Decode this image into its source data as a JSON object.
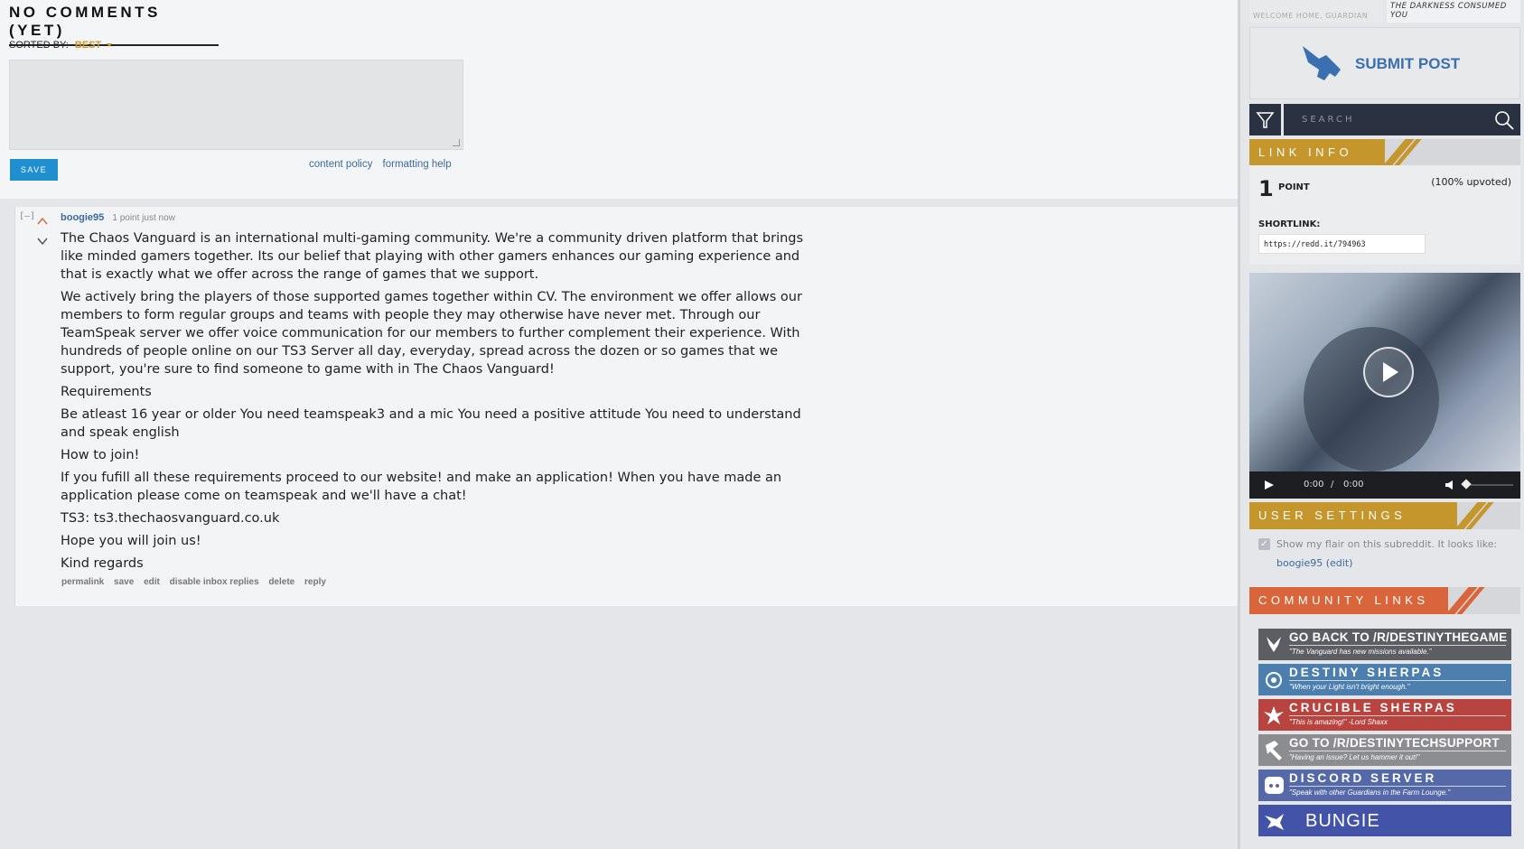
{
  "comments_header": "NO COMMENTS (YET)",
  "sort": {
    "label": "SORTED BY:",
    "value": "BEST"
  },
  "editor": {
    "save_label": "SAVE",
    "content_policy": "content policy",
    "formatting_help": "formatting help"
  },
  "comment": {
    "collapse": "[–]",
    "author": "boogie95",
    "meta": "1 point just now",
    "paragraphs": [
      "The Chaos Vanguard is an international multi-gaming community. We're a community driven platform that brings like minded gamers together. Its our belief that playing with other gamers enhances our gaming experience and that is exactly what we offer across the range of games that we support.",
      "We actively bring the players of those supported games together within CV. The environment we offer allows our members to form regular groups and teams with people they may otherwise have never met. Through our TeamSpeak server we offer voice communication for our members to further complement their experience. With hundreds of people online on our TS3 Server all day, everyday, spread across the dozen or so games that we support, you're sure to find someone to game with in The Chaos Vanguard!",
      "Requirements",
      "Be atleast 16 year or older You need teamspeak3 and a mic You need a positive attitude You need to understand and speak english",
      "How to join!",
      "If you fufill all these requirements proceed to our website! and make an application! When you have made an application please come on teamspeak and we'll have a chat!",
      "TS3: ts3.thechaosvanguard.co.uk",
      "Hope you will join us!",
      "Kind regards"
    ],
    "actions": [
      "permalink",
      "save",
      "edit",
      "disable inbox replies",
      "delete",
      "reply"
    ]
  },
  "sidebar": {
    "top_images": [
      "WELCOME HOME, GUARDIAN",
      "THE DARKNESS CONSUMED YOU"
    ],
    "submit_label": "SUBMIT POST",
    "search_placeholder": "SEARCH",
    "link_info": {
      "header": "LINK INFO",
      "points": "1",
      "points_label": "POINT",
      "upvoted": "(100% upvoted)",
      "shortlink_label": "SHORTLINK:",
      "shortlink": "https://redd.it/794963"
    },
    "video": {
      "time": "0:00",
      "sep": "/",
      "duration": "0:00"
    },
    "user_settings": {
      "header": "USER SETTINGS",
      "flair_text": "Show my flair on this subreddit. It looks like:",
      "flair_user": "boogie95",
      "flair_edit": "(edit)"
    },
    "community_links": {
      "header": "COMMUNITY LINKS",
      "items": [
        {
          "title": "GO BACK TO /R/DESTINYTHEGAME",
          "subtitle": "\"The Vanguard has new missions available.\"",
          "color": "#5c5e63"
        },
        {
          "title": "DESTINY SHERPAS",
          "subtitle": "\"When your Light isn't bright enough.\"",
          "color": "#4c7fae"
        },
        {
          "title": "CRUCIBLE SHERPAS",
          "subtitle": "\"This is amazing!\" -Lord Shaxx",
          "color": "#b8443f"
        },
        {
          "title": "GO TO /R/DESTINYTECHSUPPORT",
          "subtitle": "\"Having an issue? Let us hammer it out!\"",
          "color": "#8c8d90"
        },
        {
          "title": "DISCORD SERVER",
          "subtitle": "\"Speak with other Guardians in the Farm Lounge.\"",
          "color": "#5569a8"
        },
        {
          "title": "BUNGIE",
          "subtitle": "",
          "color": "#4353a8"
        }
      ]
    }
  }
}
